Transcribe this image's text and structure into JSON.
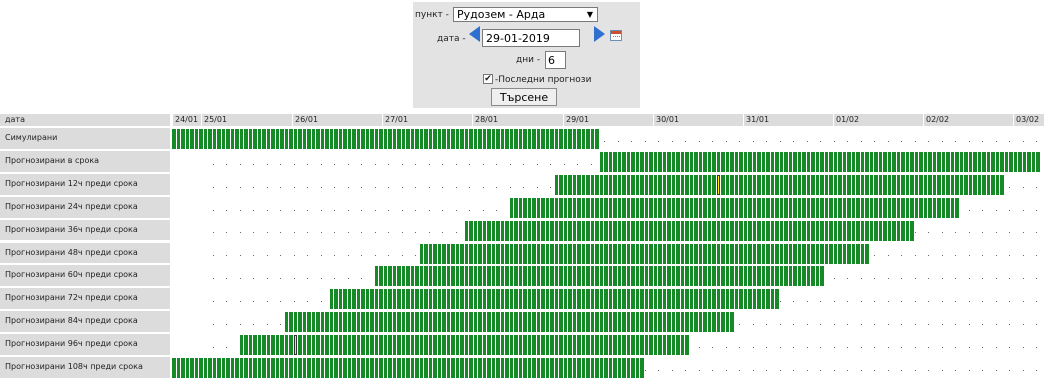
{
  "form": {
    "station_label": "пункт -",
    "station_value": "Рудозем - Арда",
    "date_label": "дата -",
    "date_value": "29-01-2019",
    "days_label": "дни -",
    "days_value": "6",
    "latest_label": "-Последни прогнози",
    "latest_checked": true,
    "search_label": "Търсене"
  },
  "grid": {
    "header_label": "дата",
    "dates": [
      "24/01",
      "25/01",
      "26/01",
      "27/01",
      "28/01",
      "29/01",
      "30/01",
      "31/01",
      "01/02",
      "02/02",
      "03/02"
    ],
    "colors": {
      "data": "#158a26",
      "highlight": "#ffee00",
      "header": "#dcdcdc"
    },
    "rows": [
      {
        "label": "Симулирани",
        "first": 0,
        "last": 94,
        "highlight": []
      },
      {
        "label": "Прогнозирани в срока",
        "first": 95,
        "last": 194,
        "highlight": []
      },
      {
        "label": "Прогнозирани 12ч преди срока",
        "first": 85,
        "last": 184,
        "highlight": [
          121
        ]
      },
      {
        "label": "Прогнозирани 24ч преди срока",
        "first": 75,
        "last": 174,
        "highlight": []
      },
      {
        "label": "Прогнозирани 36ч преди срока",
        "first": 65,
        "last": 164,
        "highlight": []
      },
      {
        "label": "Прогнозирани 48ч преди срока",
        "first": 55,
        "last": 154,
        "highlight": []
      },
      {
        "label": "Прогнозирани 60ч преди срока",
        "first": 45,
        "last": 144,
        "highlight": []
      },
      {
        "label": "Прогнозирани 72ч преди срока",
        "first": 35,
        "last": 134,
        "highlight": []
      },
      {
        "label": "Прогнозирани 84ч преди срока",
        "first": 25,
        "last": 124,
        "highlight": []
      },
      {
        "label": "Прогнозирани 96ч преди срока",
        "first": 15,
        "last": 114,
        "highlight": [
          27
        ]
      },
      {
        "label": "Прогнозирани 108ч преди срока",
        "first": 0,
        "last": 104,
        "highlight": []
      }
    ]
  }
}
